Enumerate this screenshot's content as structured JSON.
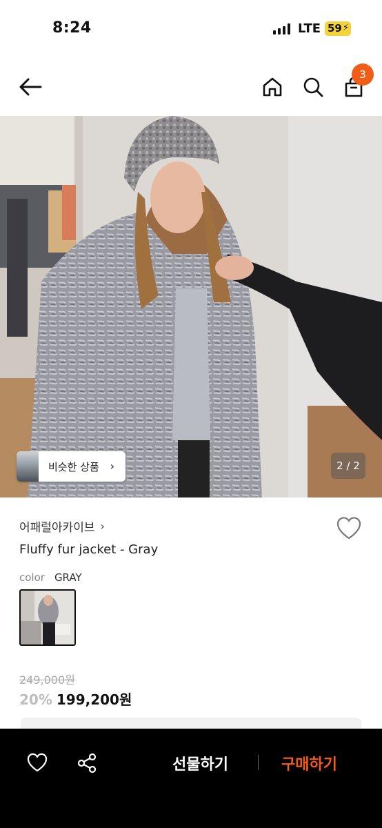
{
  "status_bar": {
    "time": "8:24",
    "network": "LTE",
    "battery": "59"
  },
  "header": {
    "back_icon": "arrow-left-icon",
    "home_icon": "home-icon",
    "search_icon": "search-icon",
    "cart_icon": "shopping-bag-icon",
    "cart_count": "3",
    "accent_color": "#f25c19"
  },
  "hero": {
    "similar_label": "비슷한 상품",
    "pager": "2 / 2"
  },
  "product": {
    "brand": "어패럴아카이브",
    "name": "Fluffy fur jacket - Gray",
    "option_key": "color",
    "option_value": "GRAY",
    "original_price": "249,000원",
    "discount": "20%",
    "price": "199,200원"
  },
  "bottom_bar": {
    "like_icon": "heart-icon",
    "share_icon": "share-icon",
    "gift_label": "선물하기",
    "buy_label": "구매하기"
  }
}
